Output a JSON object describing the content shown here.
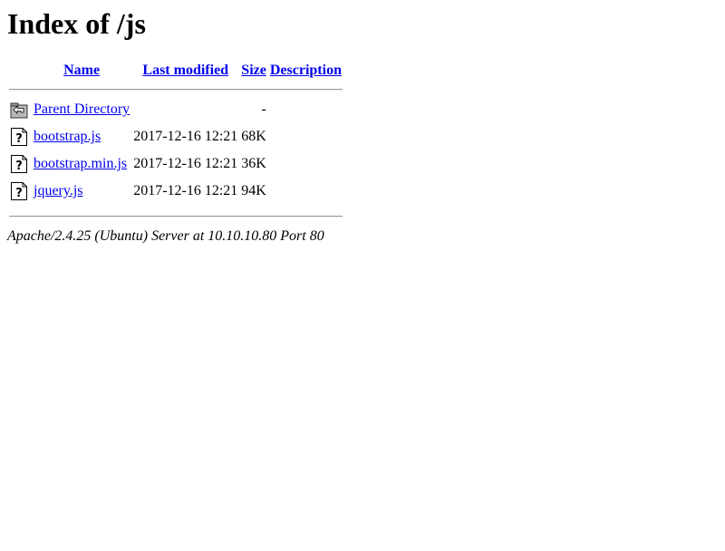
{
  "page": {
    "title": "Index of /js"
  },
  "table": {
    "headers": {
      "name": "Name",
      "last_modified": "Last modified",
      "size": "Size",
      "description": "Description"
    },
    "rows": [
      {
        "icon": "back-folder-icon",
        "name": "Parent Directory",
        "last_modified": "",
        "size": "-",
        "description": ""
      },
      {
        "icon": "unknown-file-icon",
        "name": "bootstrap.js",
        "last_modified": "2017-12-16 12:21",
        "size": "68K",
        "description": ""
      },
      {
        "icon": "unknown-file-icon",
        "name": "bootstrap.min.js",
        "last_modified": "2017-12-16 12:21",
        "size": "36K",
        "description": ""
      },
      {
        "icon": "unknown-file-icon",
        "name": "jquery.js",
        "last_modified": "2017-12-16 12:21",
        "size": "94K",
        "description": ""
      }
    ]
  },
  "footer": {
    "server_signature": "Apache/2.4.25 (Ubuntu) Server at 10.10.10.80 Port 80"
  },
  "colors": {
    "link": "#0000ee"
  }
}
